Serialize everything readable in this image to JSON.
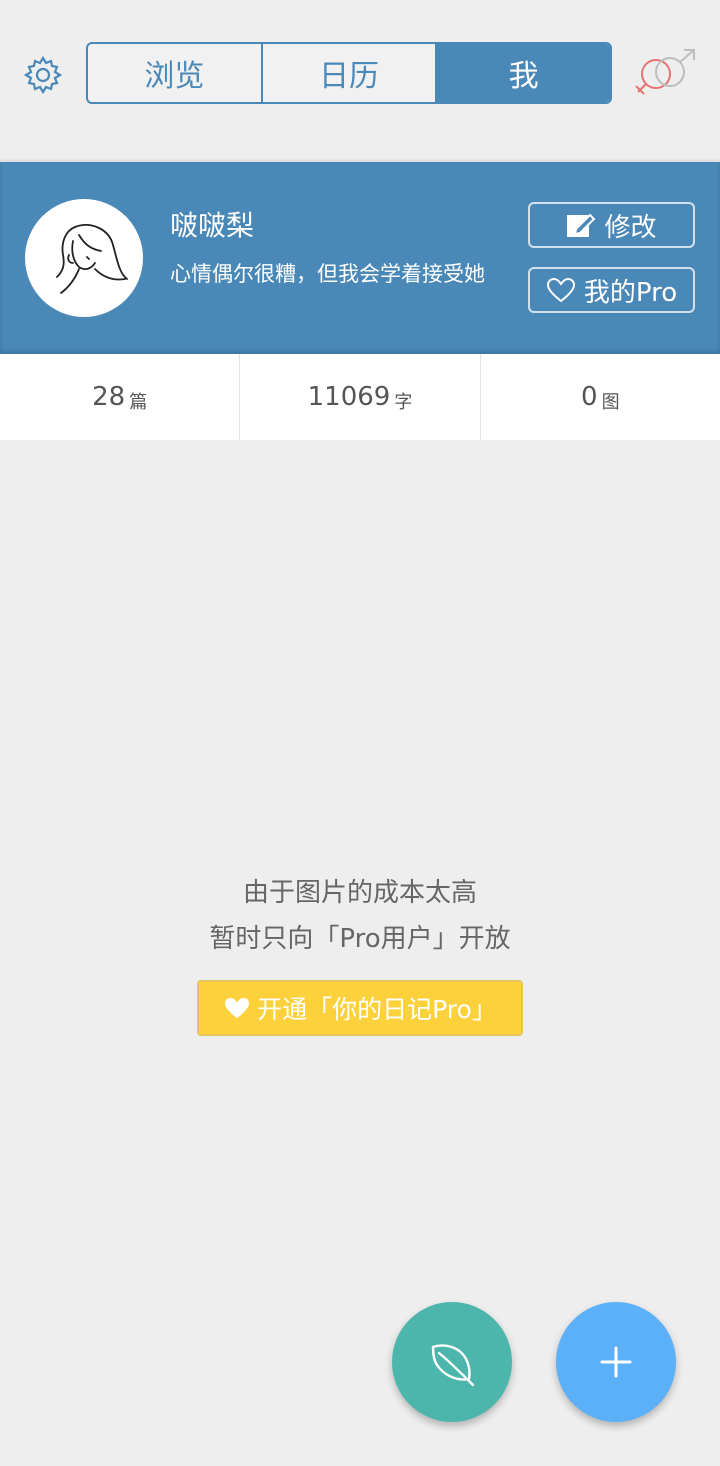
{
  "header": {
    "tabs": [
      {
        "label": "浏览",
        "active": false
      },
      {
        "label": "日历",
        "active": false
      },
      {
        "label": "我",
        "active": true
      }
    ],
    "icons": {
      "settings": "gear-icon",
      "gender": "gender-symbol-icon"
    }
  },
  "profile": {
    "username": "啵啵梨",
    "bio": "心情偶尔很糟，但我会学着接受她",
    "edit_label": "修改",
    "pro_label": "我的Pro"
  },
  "stats": [
    {
      "value": "28",
      "unit": "篇"
    },
    {
      "value": "11069",
      "unit": "字"
    },
    {
      "value": "0",
      "unit": "图"
    }
  ],
  "notice": {
    "line1": "由于图片的成本太高",
    "line2": "暂时只向「Pro用户」开放",
    "button": "开通「你的日记Pro」"
  },
  "fabs": {
    "left": "leaf-icon",
    "right": "plus-icon"
  },
  "colors": {
    "primary": "#4a88b8",
    "background": "#eeeeee",
    "pro_yellow": "#fdd13c",
    "fab_teal": "#4db6ac",
    "fab_blue": "#5cb0f8"
  }
}
